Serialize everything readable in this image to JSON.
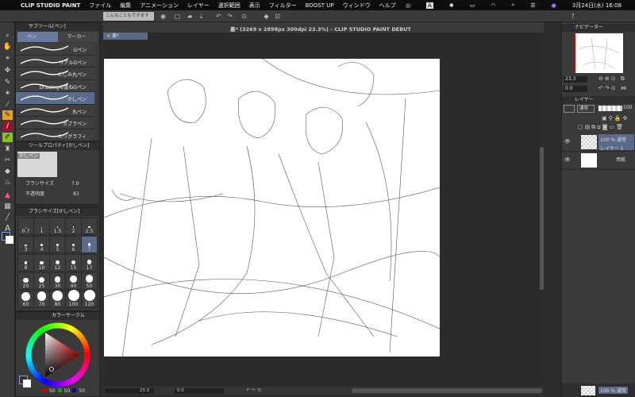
{
  "menubar": {
    "app": "CLIP STUDIO PAINT",
    "items": [
      "ファイル",
      "編集",
      "アニメーション",
      "レイヤー",
      "選択範囲",
      "表示",
      "フィルター",
      "BOOST UP",
      "ウィンドウ",
      "ヘルプ"
    ],
    "clock": "3月24日(水) 16:08",
    "input_indicator": "A"
  },
  "toolbar": {
    "hint": "こんなこともできます"
  },
  "document": {
    "tab": "裏*",
    "title": "裏* (3269 x 2898px 300dpi 23.3%)  - CLIP STUDIO PAINT DEBUT"
  },
  "subtool": {
    "title": "サブツール[ペン]",
    "tabs": [
      "ペン",
      "マーカー"
    ],
    "brushes": [
      "Gペン",
      "リアルGペン",
      "にじみ丸ペン",
      "Drawing4/重ねGペン",
      "かしペン",
      "丸ペン",
      "カブラペン",
      "カリグラフィ"
    ],
    "selected": 4
  },
  "toolprop": {
    "title": "ツールプロパティ[かしペン]",
    "preview_label": "かしペン",
    "brush_size_label": "ブラシサイズ",
    "brush_size": "7.0",
    "opacity_label": "不透明度",
    "opacity": "83"
  },
  "brushsize": {
    "title": "ブラシサイズ[かしペン]",
    "sizes": [
      "0.7",
      "1",
      "1.5",
      "2",
      "2.5",
      "3",
      "4",
      "5",
      "6",
      "7",
      "8",
      "10",
      "12",
      "15",
      "17",
      "20",
      "25",
      "30",
      "40",
      "50",
      "60",
      "70",
      "80",
      "100",
      "120"
    ],
    "selected": "7"
  },
  "colorcircle": {
    "title": "カラーサークル",
    "r": "50",
    "g": "50",
    "b": "50",
    "colors": {
      "main": "#333333",
      "sub": "#ffffff"
    }
  },
  "navigator": {
    "title": "ナビゲーター",
    "zoom": "23.3",
    "rotation": "0.0"
  },
  "layers": {
    "title": "レイヤー",
    "blend": "通常",
    "opacity": "100",
    "items": [
      {
        "mode": "100 % 通常",
        "name": "レイヤー 1",
        "selected": true
      },
      {
        "mode": "",
        "name": "用紙",
        "selected": false
      }
    ]
  },
  "bottom": {
    "zoom": "23.3",
    "rotation": "0.0",
    "layer_mode": "100 % 通常"
  },
  "accent": "#5a6a8a"
}
